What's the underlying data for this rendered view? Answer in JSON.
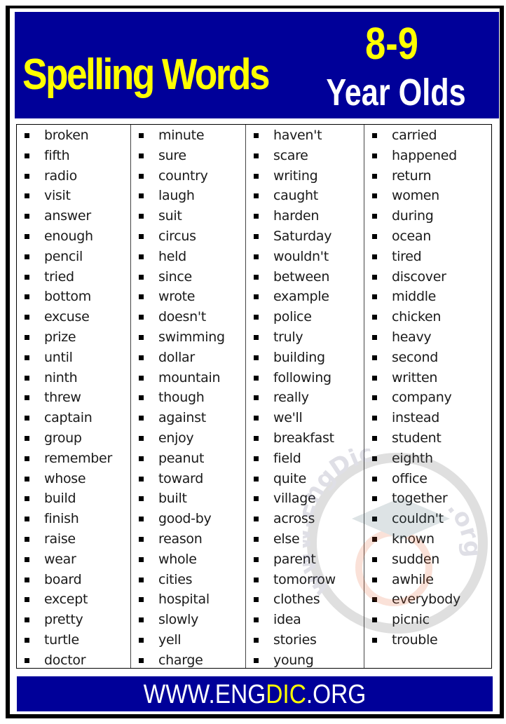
{
  "header": {
    "title": "Spelling Words",
    "age_range": "8-9",
    "subtitle": "Year Olds"
  },
  "colors": {
    "banner_bg": "#000099",
    "title_yellow": "#ffff00",
    "subtitle_white": "#ffffff",
    "frame": "#000000"
  },
  "columns": [
    [
      "broken",
      "fifth",
      "radio",
      "visit",
      "answer",
      "enough",
      "pencil",
      "tried",
      "bottom",
      "excuse",
      "prize",
      "until",
      "ninth",
      "threw",
      "captain",
      "group",
      "remember",
      "whose",
      "build",
      "finish",
      "raise",
      "wear",
      "board",
      "except",
      "pretty",
      "turtle",
      "doctor"
    ],
    [
      "minute",
      "sure",
      "country",
      "laugh",
      "suit",
      "circus",
      "held",
      "since",
      "wrote",
      "doesn't",
      "swimming",
      "dollar",
      "mountain",
      "though",
      "against",
      "enjoy",
      "peanut",
      "toward",
      "built",
      "good-by",
      "reason",
      "whole",
      "cities",
      "hospital",
      "slowly",
      "yell",
      "charge"
    ],
    [
      "haven't",
      "scare",
      "writing",
      "caught",
      "harden",
      "Saturday",
      "wouldn't",
      "between",
      "example",
      "police",
      "truly",
      "building",
      "following",
      "really",
      "we'll",
      "breakfast",
      "field",
      "quite",
      "village",
      "across",
      "else",
      "parent",
      "tomorrow",
      "clothes",
      "idea",
      "stories",
      "young"
    ],
    [
      "carried",
      "happened",
      "return",
      "women",
      "during",
      "ocean",
      "tired",
      "discover",
      "middle",
      "chicken",
      "heavy",
      "second",
      "written",
      "company",
      "instead",
      "student",
      "eighth",
      "office",
      "together",
      "couldn't",
      "known",
      "sudden",
      "awhile",
      "everybody",
      "picnic",
      "trouble"
    ]
  ],
  "bullet_icon": "square-bullet-icon",
  "watermark": {
    "text_left": "www.EngDic",
    "text_right": ".org",
    "icon": "graduation-cap-icon"
  },
  "footer": {
    "prefix": "WWW.ENG",
    "highlight": "DIC",
    "suffix": ".ORG"
  }
}
